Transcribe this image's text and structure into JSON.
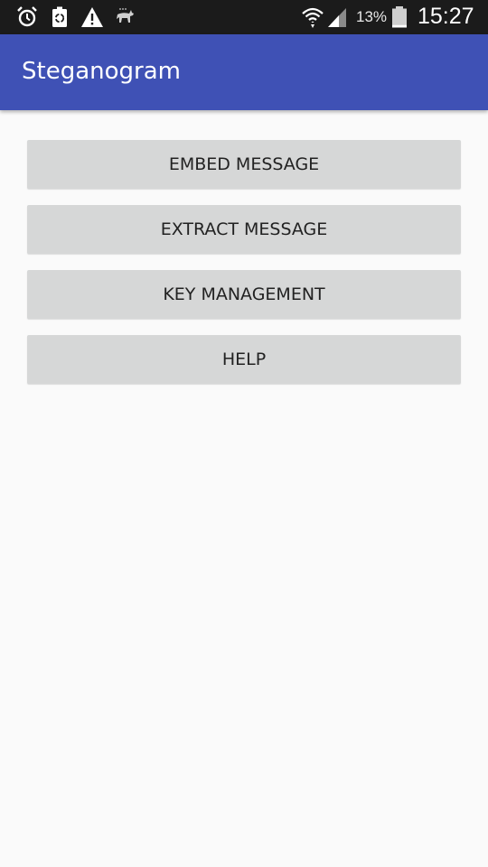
{
  "status_bar": {
    "icons_left": [
      "alarm-icon",
      "recycle-battery-icon",
      "warning-icon",
      "animal-notification-icon"
    ],
    "icons_right": [
      "wifi-icon",
      "signal-icon",
      "battery-icon"
    ],
    "battery_percent": "13%",
    "battery_level": 0.13,
    "time": "15:27"
  },
  "app_bar": {
    "title": "Steganogram",
    "color": "#3f51b5"
  },
  "menu": {
    "buttons": [
      {
        "label": "EMBED MESSAGE"
      },
      {
        "label": "EXTRACT MESSAGE"
      },
      {
        "label": "KEY MANAGEMENT"
      },
      {
        "label": "HELP"
      }
    ]
  }
}
